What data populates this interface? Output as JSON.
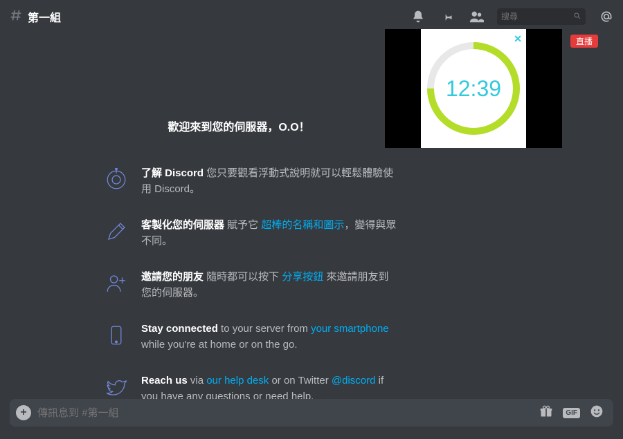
{
  "colors": {
    "accent": "#7289da",
    "link": "#00aff4",
    "timer": "#33c9dd",
    "pipRing": "#b4dd29",
    "live": "#e63b3b"
  },
  "topbar": {
    "channel_name": "第一組",
    "search_placeholder": "搜尋"
  },
  "pip": {
    "time": "12:39",
    "live_label": "直播",
    "close_glyph": "✕"
  },
  "welcome": {
    "heading": "歡迎來到您的伺服器，O.O！",
    "steps": [
      {
        "icon": "exclamation-circle-icon",
        "lead": "了解 Discord",
        "mid": " 您只要觀看浮動式說明就可以輕鬆體驗使用 Discord。",
        "link": "",
        "tail": ""
      },
      {
        "icon": "pencil-icon",
        "lead": "客製化您的伺服器",
        "mid": " 賦予它 ",
        "link": "超棒的名稱和圖示",
        "tail": "，變得與眾不同。"
      },
      {
        "icon": "invite-user-icon",
        "lead": "邀請您的朋友",
        "mid": " 隨時都可以按下 ",
        "link": "分享按鈕",
        "tail": " 來邀請朋友到您的伺服器。"
      },
      {
        "icon": "phone-icon",
        "lead": "Stay connected",
        "mid": " to your server from ",
        "link": "your smartphone",
        "tail": " while you're at home or on the go."
      },
      {
        "icon": "twitter-icon",
        "lead": "Reach us",
        "mid": " via ",
        "link": "our help desk",
        "tail": " or on Twitter ",
        "link2": "@discord",
        "tail2": " if you have any questions or need help."
      }
    ]
  },
  "composer": {
    "placeholder": "傳訊息到 #第一組",
    "gif_label": "GIF"
  }
}
